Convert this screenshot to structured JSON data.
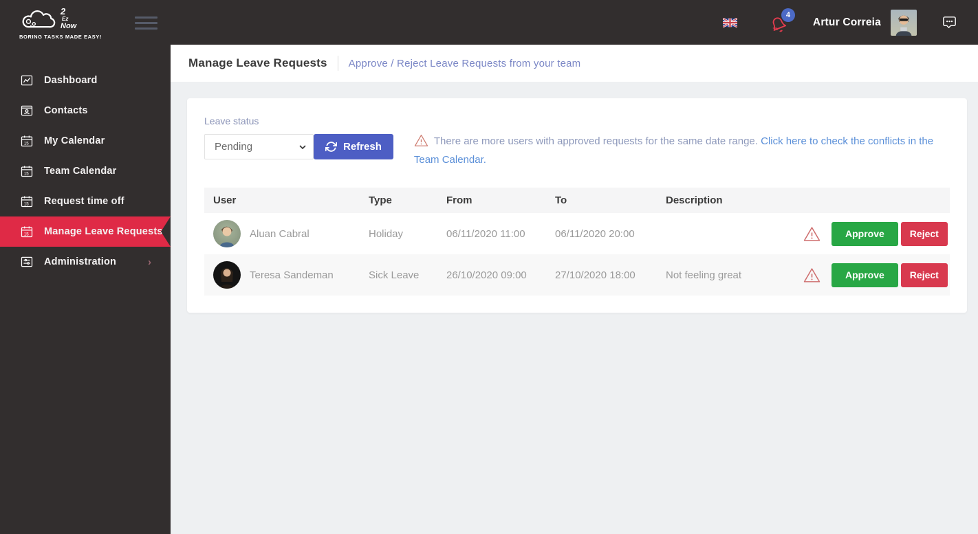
{
  "brand": {
    "logo_2": "2",
    "logo_ez": "Ez",
    "logo_now": "Now",
    "tagline": "BORING TASKS MADE EASY!"
  },
  "topbar": {
    "user_name": "Artur Correia",
    "notification_count": "4"
  },
  "sidebar": {
    "items": [
      {
        "key": "dashboard",
        "label": "Dashboard",
        "icon": "dashboard-icon",
        "active": false,
        "has_submenu": false
      },
      {
        "key": "contacts",
        "label": "Contacts",
        "icon": "contacts-icon",
        "active": false,
        "has_submenu": false
      },
      {
        "key": "my-calendar",
        "label": "My Calendar",
        "icon": "calendar-icon",
        "active": false,
        "has_submenu": false
      },
      {
        "key": "team-calendar",
        "label": "Team Calendar",
        "icon": "calendar-icon",
        "active": false,
        "has_submenu": false
      },
      {
        "key": "request-time-off",
        "label": "Request time off",
        "icon": "calendar-icon",
        "active": false,
        "has_submenu": false
      },
      {
        "key": "manage-leave-requests",
        "label": "Manage Leave Requests",
        "icon": "calendar-icon",
        "active": true,
        "has_submenu": false
      },
      {
        "key": "administration",
        "label": "Administration",
        "icon": "admin-icon",
        "active": false,
        "has_submenu": true
      }
    ]
  },
  "page_header": {
    "title": "Manage Leave Requests",
    "subtitle": "Approve / Reject Leave Requests from your team"
  },
  "filters": {
    "label": "Leave status",
    "selected": "Pending",
    "refresh_label": "Refresh"
  },
  "alert": {
    "text": "There are more users with approved requests for the same date range.",
    "link_text": "Click here to check the conflicts in the Team Calendar."
  },
  "table": {
    "columns": [
      "User",
      "Type",
      "From",
      "To",
      "Description"
    ],
    "approve_label": "Approve",
    "reject_label": "Reject",
    "rows": [
      {
        "user": "Aluan Cabral",
        "avatar": "aluan",
        "type": "Holiday",
        "from": "06/11/2020 11:00",
        "to": "06/11/2020 20:00",
        "description": ""
      },
      {
        "user": "Teresa Sandeman",
        "avatar": "teresa",
        "type": "Sick Leave",
        "from": "26/10/2020 09:00",
        "to": "27/10/2020 18:00",
        "description": "Not feeling great"
      }
    ]
  },
  "colors": {
    "sidebar_bg": "#322e2e",
    "accent_red": "#df2a46",
    "refresh_blue": "#4d5ec4",
    "badge_blue": "#4c6ac6",
    "approve_green": "#28a745",
    "reject_red": "#d8394e",
    "link_blue": "#5a8fd8",
    "subtitle_blue": "#7b87c6",
    "muted_text": "#8e99bb",
    "content_bg": "#eef0f2"
  }
}
